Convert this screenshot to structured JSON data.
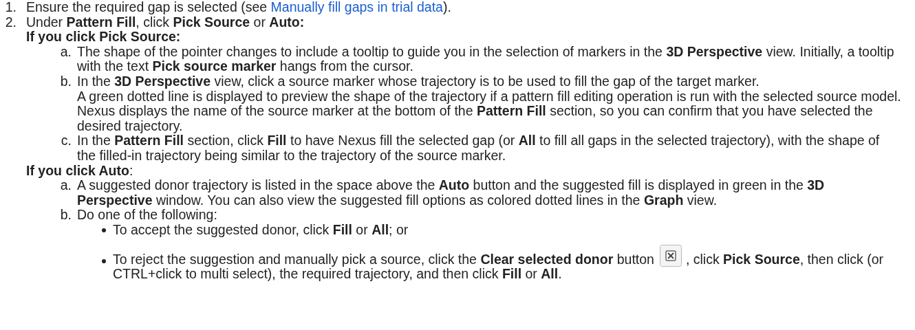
{
  "steps": [
    {
      "number": "1.",
      "before": "Ensure the required gap is selected (see ",
      "link": "Manually fill gaps in trial data",
      "after": ")."
    },
    {
      "number": "2.",
      "text": "Under **Pattern Fill**, click **Pick Source** or **Auto:**",
      "branches": [
        {
          "heading": "**If you click Pick Source:**",
          "substeps": [
            {
              "letter": "a.",
              "paragraphs": [
                "The shape of the pointer changes to include a tooltip to guide you in the selection of markers in the **3D Perspective** view. Initially, a tooltip with the text **Pick source marker** hangs from the cursor."
              ]
            },
            {
              "letter": "b.",
              "paragraphs": [
                "In the **3D Perspective** view, click a source marker whose trajectory is to be used to fill the gap of the target marker.",
                "A green dotted line is displayed to preview the shape of the trajectory if a pattern fill editing operation is run with the selected source model.",
                "Nexus displays the name of the source marker at the bottom of the **Pattern Fill** section, so you can confirm that you have selected the desired trajectory."
              ]
            },
            {
              "letter": "c.",
              "paragraphs": [
                "In the **Pattern Fill** section, click **Fill** to have Nexus fill the selected gap (or **All** to fill all gaps in the selected trajectory), with the shape of the filled-in trajectory being similar to the trajectory of the source marker."
              ]
            }
          ]
        },
        {
          "heading": "**If you click Auto**:",
          "substeps": [
            {
              "letter": "a.",
              "paragraphs": [
                "A suggested donor trajectory is listed in the space above the **Auto** button and the suggested fill is displayed in green in the **3D Perspective** window. You can also view the suggested fill options as colored dotted lines in the **Graph** view."
              ]
            },
            {
              "letter": "b.",
              "paragraphs": [
                "Do one of the following:"
              ],
              "bullets": [
                {
                  "text": "To accept the suggested donor, click **Fill** or **All**; or"
                },
                {
                  "text": "To reject the suggestion and manually pick a source, click the **Clear selected donor** button",
                  "after": ", click **Pick Source**, then click (or CTRL+click to multi select), the required trajectory, and then click **Fill** or **All**."
                }
              ]
            }
          ]
        }
      ]
    }
  ]
}
